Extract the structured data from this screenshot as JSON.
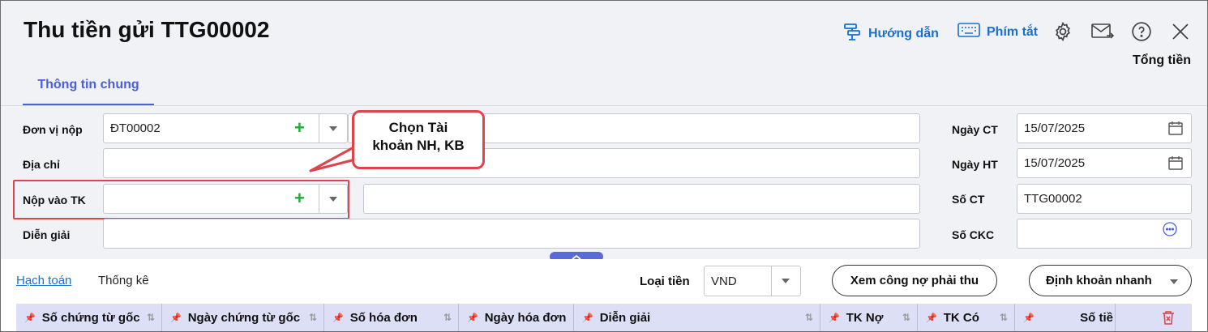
{
  "header": {
    "title": "Thu tiền gửi TTG00002",
    "guide_label": "Hướng dẫn",
    "shortcut_label": "Phím tắt",
    "total_label": "Tổng tiền",
    "accent": "#1a6fd1"
  },
  "tabs": {
    "general": "Thông tin chung"
  },
  "form": {
    "payer_unit": {
      "label": "Đơn vị nộp",
      "value": "ĐT00002",
      "name_value": ""
    },
    "address": {
      "label": "Địa chỉ",
      "value": ""
    },
    "deposit_account": {
      "label": "Nộp vào TK",
      "value": "",
      "name_value": ""
    },
    "description": {
      "label": "Diễn giải",
      "value": ""
    },
    "doc_date": {
      "label": "Ngày CT",
      "value": "15/07/2025"
    },
    "post_date": {
      "label": "Ngày HT",
      "value": "15/07/2025"
    },
    "doc_no": {
      "label": "Số CT",
      "value": "TTG00002"
    },
    "ckc_no": {
      "label": "Số CKC",
      "value": ""
    }
  },
  "callout": {
    "line1": "Chọn Tài",
    "line2": "khoản NH, KB",
    "color": "#e0434a"
  },
  "bottom": {
    "tab_accounting": "Hạch toán",
    "tab_stats": "Thống kê",
    "currency_label": "Loại tiền",
    "currency_value": "VND",
    "debt_button": "Xem công nợ phải thu",
    "quick_entry_button": "Định khoản nhanh"
  },
  "grid": {
    "columns": [
      "Số chứng từ gốc",
      "Ngày chứng từ gốc",
      "Số hóa đơn",
      "Ngày hóa đơn",
      "Diễn giải",
      "TK Nợ",
      "TK Có",
      "Số tiề"
    ]
  }
}
